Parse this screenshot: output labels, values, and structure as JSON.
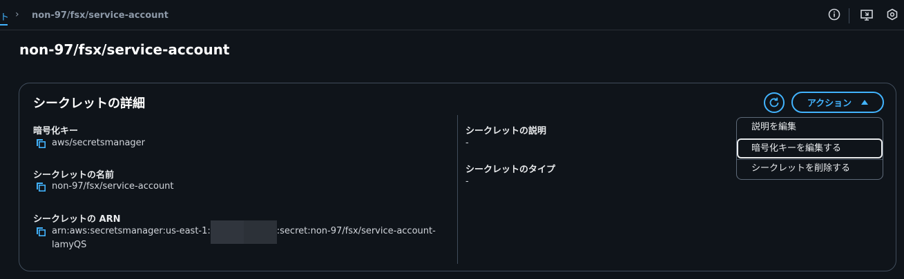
{
  "breadcrumb": {
    "previous": "ト",
    "current": "non-97/fsx/service-account"
  },
  "page": {
    "title": "non-97/fsx/service-account"
  },
  "details": {
    "title": "シークレットの詳細",
    "actions_label": "アクション",
    "left": {
      "encryption_key": {
        "label": "暗号化キー",
        "value": "aws/secretsmanager"
      },
      "secret_name": {
        "label": "シークレットの名前",
        "value": "non-97/fsx/service-account"
      },
      "secret_arn": {
        "label": "シークレットの ARN",
        "value_prefix": "arn:aws:secretsmanager:us-east-1:",
        "value_suffix": ":secret:non-97/fsx/service-account-",
        "value_line2": "lamyQS"
      }
    },
    "right": {
      "description": {
        "label": "シークレットの説明",
        "value": "-"
      },
      "type": {
        "label": "シークレットのタイプ",
        "value": "-"
      }
    }
  },
  "menu": {
    "items": [
      {
        "label": "説明を編集"
      },
      {
        "label": "暗号化キーを編集する"
      },
      {
        "label": "シークレットを削除する"
      }
    ]
  },
  "colors": {
    "accent": "#42b4ff",
    "background": "#0f141a",
    "border": "#414d5c"
  },
  "icons": [
    "chevron-right-icon",
    "info-icon",
    "screen-icon",
    "settings-icon",
    "copy-icon",
    "refresh-icon",
    "caret-up-icon"
  ]
}
